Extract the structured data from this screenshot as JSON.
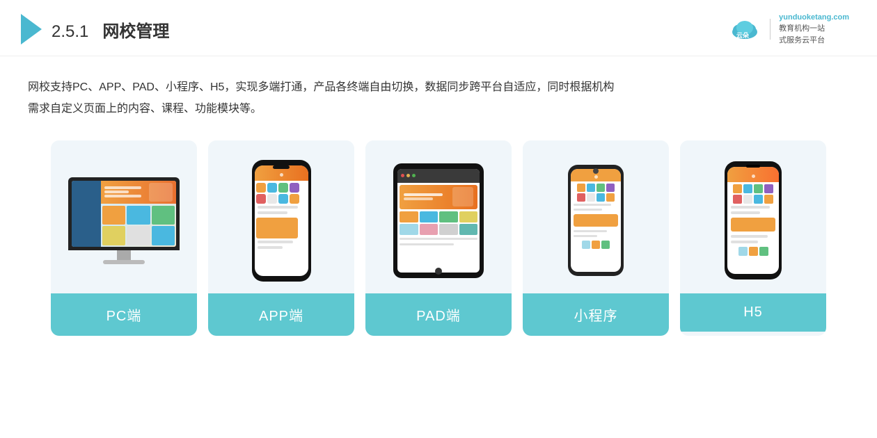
{
  "header": {
    "section_number": "2.5.1",
    "title_bold": "网校管理",
    "brand": {
      "url": "yunduoketang.com",
      "slogan_line1": "教育机构一站",
      "slogan_line2": "式服务云平台"
    }
  },
  "description": {
    "line1": "网校支持PC、APP、PAD、小程序、H5，实现多端打通，产品各终端自由切换，数据同步跨平台自适应，同时根据机构",
    "line2": "需求自定义页面上的内容、课程、功能模块等。"
  },
  "cards": [
    {
      "id": "pc",
      "label": "PC端",
      "device_type": "monitor"
    },
    {
      "id": "app",
      "label": "APP端",
      "device_type": "phone"
    },
    {
      "id": "pad",
      "label": "PAD端",
      "device_type": "tablet"
    },
    {
      "id": "miniprogram",
      "label": "小程序",
      "device_type": "small-phone"
    },
    {
      "id": "h5",
      "label": "H5",
      "device_type": "h5-phone"
    }
  ]
}
